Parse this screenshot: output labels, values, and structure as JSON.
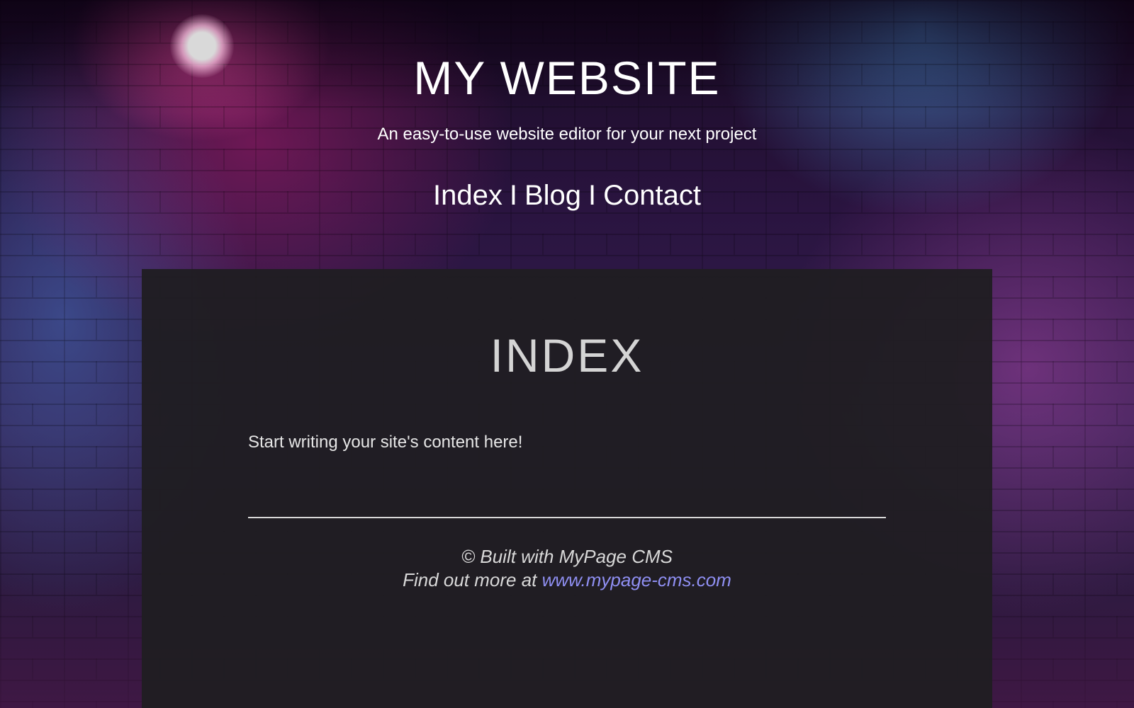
{
  "header": {
    "title": "MY WEBSITE",
    "tagline": "An easy-to-use website editor for your next project"
  },
  "nav": {
    "items": [
      {
        "label": "Index"
      },
      {
        "label": "Blog"
      },
      {
        "label": "Contact"
      }
    ],
    "separator": "I"
  },
  "main": {
    "heading": "INDEX",
    "body": "Start writing your site's content here!"
  },
  "footer": {
    "built_with": "© Built with MyPage CMS",
    "find_more_prefix": "Find out more at",
    "link_text": "www.mypage-cms.com"
  },
  "colors": {
    "panel_background": "#201e22",
    "link": "#8f8ff2",
    "text": "#ffffff"
  }
}
